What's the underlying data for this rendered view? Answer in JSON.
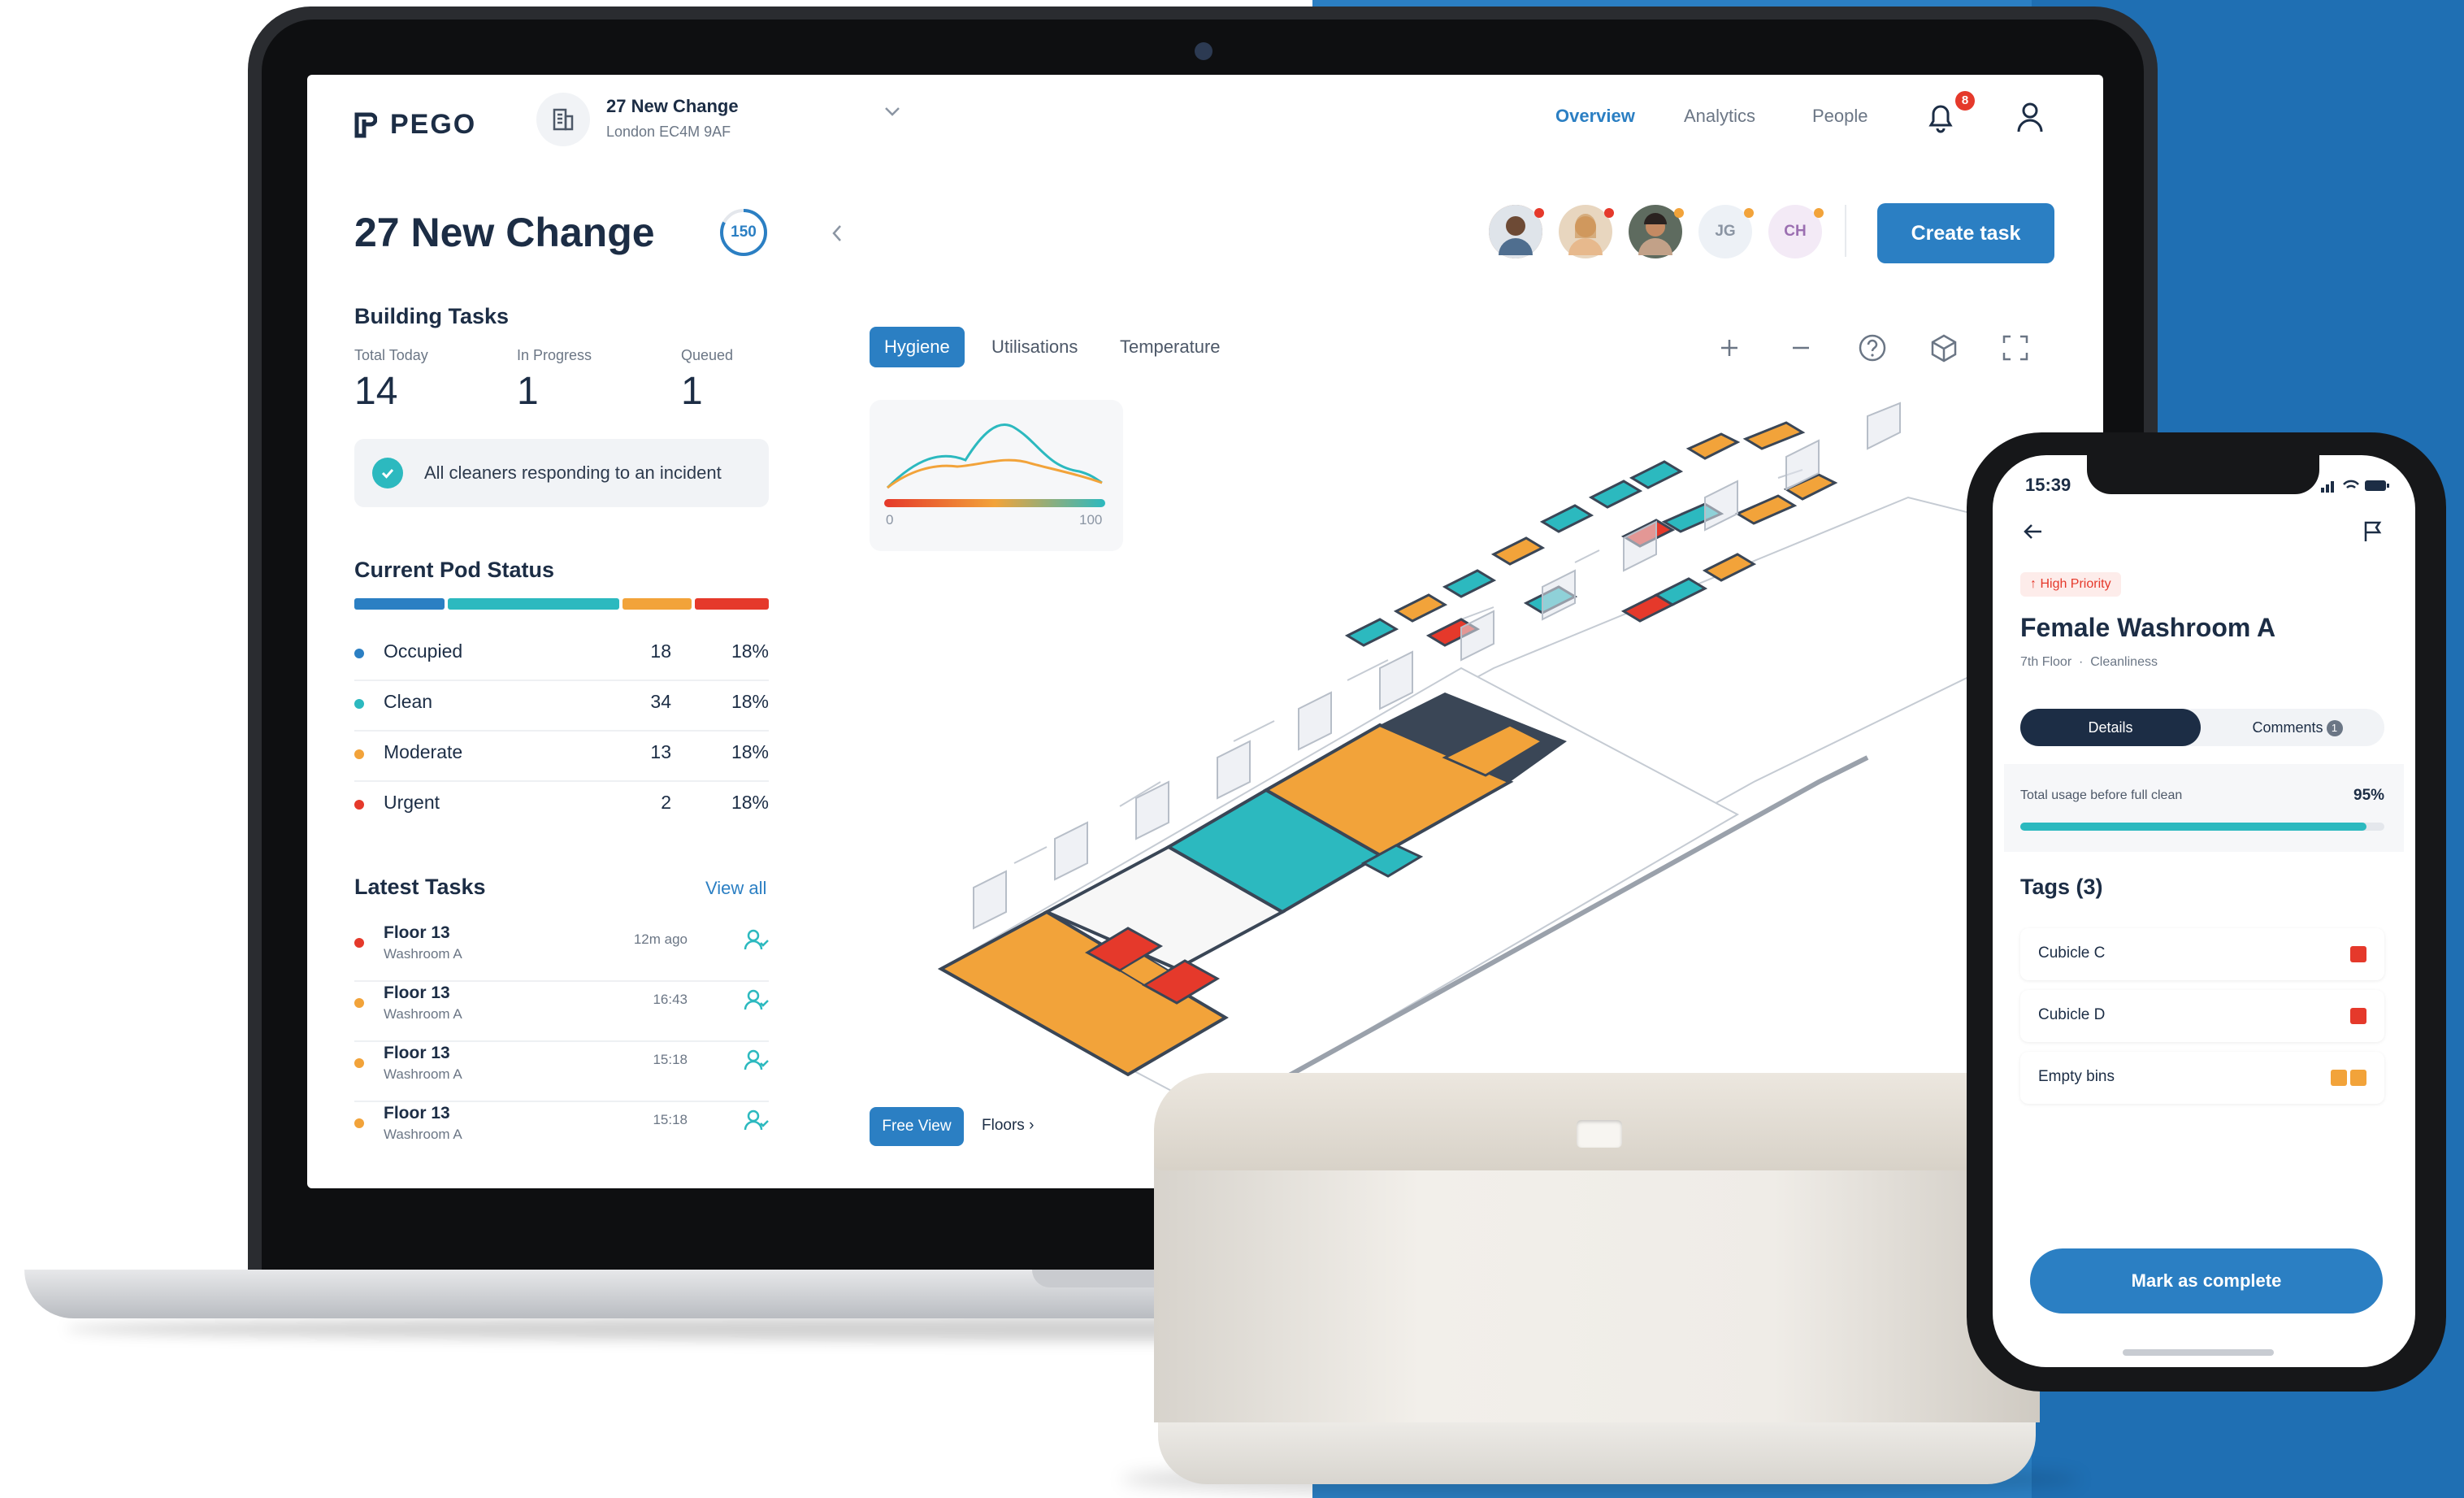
{
  "brand": {
    "name": "PEGO"
  },
  "building": {
    "name": "27 New Change",
    "address": "London EC4M 9AF"
  },
  "nav": {
    "items": [
      "Overview",
      "Analytics",
      "People"
    ],
    "active": "Overview"
  },
  "notifications": {
    "count": "8"
  },
  "page": {
    "title": "27 New Change",
    "score": "150"
  },
  "building_tasks": {
    "title": "Building Tasks",
    "stats": [
      {
        "label": "Total Today",
        "value": "14"
      },
      {
        "label": "In Progress",
        "value": "1"
      },
      {
        "label": "Queued",
        "value": "1"
      }
    ],
    "alert": "All cleaners responding to an incident"
  },
  "pod_status": {
    "title": "Current Pod Status",
    "rows": [
      {
        "name": "Occupied",
        "count": "18",
        "pct": "18%",
        "color": "#2b7fc3"
      },
      {
        "name": "Clean",
        "count": "34",
        "pct": "18%",
        "color": "#2cb9bf"
      },
      {
        "name": "Moderate",
        "count": "13",
        "pct": "18%",
        "color": "#f2a33a"
      },
      {
        "name": "Urgent",
        "count": "2",
        "pct": "18%",
        "color": "#e5392b"
      }
    ]
  },
  "latest_tasks": {
    "title": "Latest Tasks",
    "view_all": "View all",
    "rows": [
      {
        "floor": "Floor 13",
        "room": "Washroom A",
        "time": "12m ago",
        "color": "#e5392b"
      },
      {
        "floor": "Floor 13",
        "room": "Washroom A",
        "time": "16:43",
        "color": "#f2a33a"
      },
      {
        "floor": "Floor 13",
        "room": "Washroom A",
        "time": "15:18",
        "color": "#f2a33a"
      },
      {
        "floor": "Floor 13",
        "room": "Washroom A",
        "time": "15:18",
        "color": "#f2a33a"
      }
    ]
  },
  "team": {
    "initials": [
      "JG",
      "CH"
    ]
  },
  "actions": {
    "create_task": "Create task"
  },
  "map_tabs": {
    "items": [
      "Hygiene",
      "Utilisations",
      "Temperature"
    ],
    "active": "Hygiene"
  },
  "legend": {
    "min": "0",
    "max": "100"
  },
  "map_footer": {
    "free_view": "Free View",
    "floors": "Floors"
  },
  "phone": {
    "time": "15:39",
    "priority": "High Priority",
    "title": "Female Washroom A",
    "floor": "7th Floor",
    "category": "Cleanliness",
    "tabs": {
      "details": "Details",
      "comments": "Comments",
      "comments_count": "1"
    },
    "usage": {
      "label": "Total usage before full clean",
      "value": "95%",
      "fraction": 0.95
    },
    "tags_title": "Tags (3)",
    "tags": [
      {
        "name": "Cubicle C",
        "colors": [
          "#e5392b"
        ]
      },
      {
        "name": "Cubicle D",
        "colors": [
          "#e5392b"
        ]
      },
      {
        "name": "Empty bins",
        "colors": [
          "#f2a33a",
          "#f2a33a"
        ]
      }
    ],
    "cta": "Mark as complete"
  },
  "colors": {
    "accent": "#2b7fc3",
    "clean": "#2cb9bf",
    "moderate": "#f2a33a",
    "urgent": "#e5392b",
    "navy": "#1c2d45"
  }
}
